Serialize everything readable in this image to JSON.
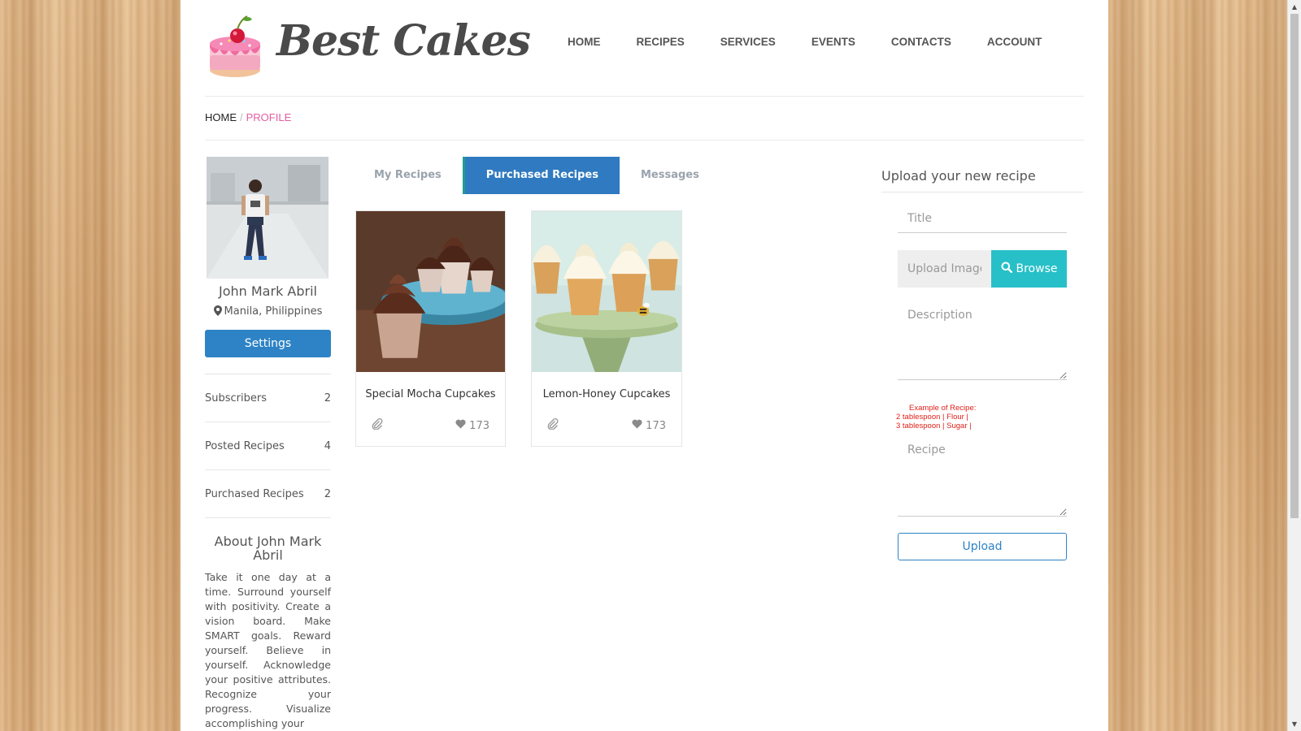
{
  "brand": {
    "name": "Best Cakes"
  },
  "nav": {
    "items": [
      {
        "label": "HOME"
      },
      {
        "label": "RECIPES"
      },
      {
        "label": "SERVICES"
      },
      {
        "label": "EVENTS"
      },
      {
        "label": "CONTACTS"
      },
      {
        "label": "ACCOUNT"
      }
    ]
  },
  "breadcrumb": {
    "home": "HOME",
    "separator": "/",
    "current": "PROFILE"
  },
  "profile": {
    "name": "John Mark Abril",
    "location": "Manila, Philippines",
    "settings_label": "Settings",
    "stats": [
      {
        "label": "Subscribers",
        "value": "2"
      },
      {
        "label": "Posted Recipes",
        "value": "4"
      },
      {
        "label": "Purchased Recipes",
        "value": "2"
      }
    ],
    "about_title": "About John Mark Abril",
    "about_text": "Take it one day at a time. Surround yourself with positivity. Create a vision board. Make SMART goals. Reward yourself. Believe in yourself. Acknowledge your positive attributes. Recognize your progress. Visualize accomplishing your"
  },
  "tabs": {
    "items": [
      {
        "label": "My Recipes"
      },
      {
        "label": "Purchased Recipes"
      },
      {
        "label": "Messages"
      }
    ],
    "active": "Purchased Recipes"
  },
  "recipes": [
    {
      "title": "Special Mocha Cupcakes",
      "likes": "173",
      "icon": "paperclip-icon"
    },
    {
      "title": "Lemon-Honey Cupcakes",
      "likes": "173",
      "icon": "paperclip-icon"
    }
  ],
  "upload": {
    "heading": "Upload your new recipe",
    "title_placeholder": "Title",
    "image_placeholder": "Upload Image",
    "browse_label": "Browse",
    "description_placeholder": "Description",
    "example_title": "Example of Recipe:",
    "example_line1": "2 tablespoon | Flour |",
    "example_line2": "3 tablespoon | Sugar |",
    "recipe_placeholder": "Recipe",
    "upload_label": "Upload"
  },
  "colors": {
    "primary": "#2d83c5",
    "accent_pink": "#e05fa0",
    "browse": "#27c0c8",
    "example_red": "#e0201a"
  }
}
